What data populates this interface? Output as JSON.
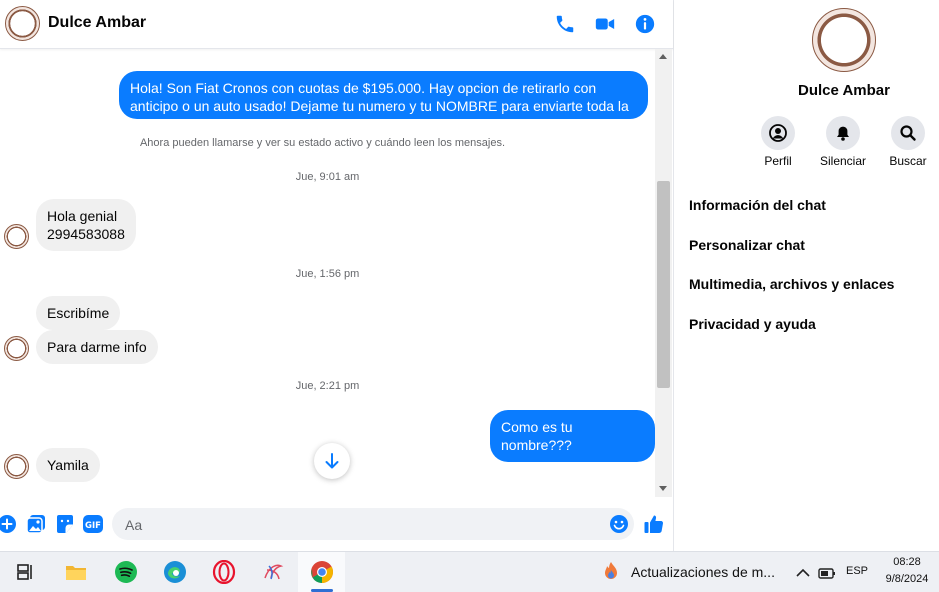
{
  "header": {
    "contact_name": "Dulce Ambar",
    "avatar_text": "Dulce Ambar"
  },
  "messages": {
    "outgoing_1": "Hola! Son Fiat Cronos con cuotas de $195.000. Hay opcion de retirarlo con anticipo o un auto usado! Dejame tu numero y tu NOMBRE para enviarte toda la informacion",
    "notice": "Ahora pueden llamarse y ver su estado activo y cuándo leen los mensajes.",
    "ts_1": "Jue, 9:01 am",
    "incoming_1": "Hola genial\n2994583088",
    "ts_2": "Jue, 1:56 pm",
    "incoming_2": "Escribíme",
    "incoming_3": "Para darme info",
    "ts_3": "Jue, 2:21 pm",
    "outgoing_2": "Como es tu nombre???",
    "incoming_4": "Yamila"
  },
  "composer": {
    "placeholder": "Aa"
  },
  "sidebar": {
    "name": "Dulce Ambar",
    "actions": [
      {
        "label": "Perfil",
        "icon": "profile-icon"
      },
      {
        "label": "Silenciar",
        "icon": "bell-icon"
      },
      {
        "label": "Buscar",
        "icon": "search-icon"
      }
    ],
    "items": [
      {
        "label": "Información del chat"
      },
      {
        "label": "Personalizar chat"
      },
      {
        "label": "Multimedia, archivos y enlaces"
      },
      {
        "label": "Privacidad y ayuda"
      }
    ]
  },
  "taskbar": {
    "notification": "Actualizaciones de m...",
    "language": "ESP",
    "time": "08:28",
    "date": "9/8/2024"
  },
  "colors": {
    "messenger_blue": "#0a7cff",
    "incoming_gray": "#f0f0f0"
  }
}
